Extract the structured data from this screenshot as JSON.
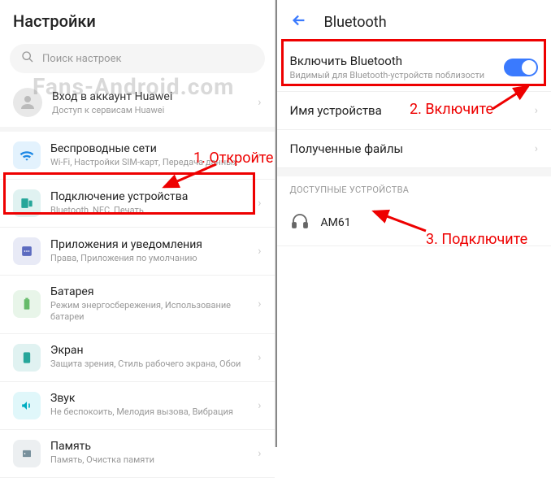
{
  "watermark": "Fans-Android.com",
  "settings": {
    "title": "Настройки",
    "search_placeholder": "Поиск настроек",
    "account": {
      "title": "Вход в аккаунт Huawei",
      "subtitle": "Доступ к сервисам Huawei"
    },
    "items": [
      {
        "title": "Беспроводные сети",
        "subtitle": "Wi-Fi, Настройки SIM-карт, Передача данных",
        "icon_bg": "#1e88e5",
        "icon": "wifi"
      },
      {
        "title": "Подключение устройства",
        "subtitle": "Bluetooth, NFC, Печать",
        "icon_bg": "#26a69a",
        "icon": "devices"
      },
      {
        "title": "Приложения и уведомления",
        "subtitle": "Права, Приложения по умолчанию",
        "icon_bg": "#5c6bc0",
        "icon": "apps"
      },
      {
        "title": "Батарея",
        "subtitle": "Режим энергосбережения, Использование батареи",
        "icon_bg": "#66bb6a",
        "icon": "battery"
      },
      {
        "title": "Экран",
        "subtitle": "Защита зрения, Стиль рабочего экрана, Обои",
        "icon_bg": "#26a69a",
        "icon": "display"
      },
      {
        "title": "Звук",
        "subtitle": "Не беспокоить, Мелодия вызова, Вибрация",
        "icon_bg": "#00acc1",
        "icon": "sound"
      },
      {
        "title": "Память",
        "subtitle": "Память, Очистка памяти",
        "icon_bg": "#78909c",
        "icon": "storage"
      }
    ]
  },
  "bluetooth": {
    "title": "Bluetooth",
    "enable": {
      "title": "Включить Bluetooth",
      "subtitle": "Видимый для Bluetooth-устройств поблизости"
    },
    "device_name_label": "Имя устройства",
    "received_label": "Полученные файлы",
    "available_header": "ДОСТУПНЫЕ УСТРОЙСТВА",
    "devices": [
      {
        "name": "AM61"
      }
    ]
  },
  "annotations": {
    "a1": "1. Откройте",
    "a2": "2. Включите",
    "a3": "3. Подключите"
  }
}
